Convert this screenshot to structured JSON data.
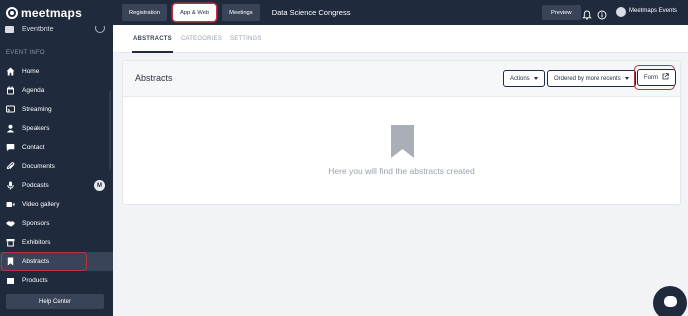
{
  "brand": {
    "name": "meetmaps"
  },
  "sidebar": {
    "cut_item_label": "Eventbrite",
    "section_label": "EVENT INFO",
    "items": [
      {
        "label": "Home",
        "icon": "home-icon"
      },
      {
        "label": "Agenda",
        "icon": "calendar-icon"
      },
      {
        "label": "Streaming",
        "icon": "streaming-icon"
      },
      {
        "label": "Speakers",
        "icon": "person-icon"
      },
      {
        "label": "Contact",
        "icon": "chat-icon"
      },
      {
        "label": "Documents",
        "icon": "paperclip-icon"
      },
      {
        "label": "Podcasts",
        "icon": "microphone-icon",
        "badge": "M"
      },
      {
        "label": "Video gallery",
        "icon": "video-icon"
      },
      {
        "label": "Sponsors",
        "icon": "handshake-icon"
      },
      {
        "label": "Exhibitors",
        "icon": "store-icon"
      },
      {
        "label": "Abstracts",
        "icon": "bookmark-icon",
        "active": true
      },
      {
        "label": "Products",
        "icon": "box-icon"
      }
    ],
    "help_label": "Help Center"
  },
  "topbar": {
    "tabs": [
      "Registration",
      "App & Web",
      "Meetings"
    ],
    "active_tab": "App & Web",
    "event_name": "Data Science Congress",
    "preview_label": "Preview",
    "user_name": "Meetmaps Events"
  },
  "subtabs": [
    "ABSTRACTS",
    "CATEGORIES",
    "SETTINGS"
  ],
  "card": {
    "title": "Abstracts",
    "actions_label": "Actions",
    "sort_label": "Ordered by more recents",
    "form_label": "Form",
    "empty_text": "Here you will find the abstracts created"
  },
  "colors": {
    "sidebar_bg": "#1f2a3d",
    "highlight": "#b8343d",
    "page_bg": "#f2f3f7"
  }
}
